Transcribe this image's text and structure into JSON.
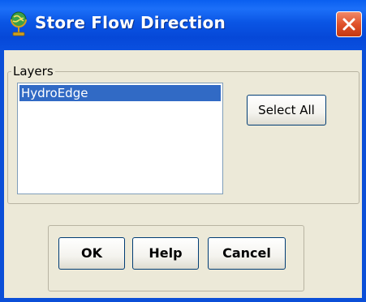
{
  "window": {
    "title": "Store Flow Direction",
    "icon": "globe-stand-icon",
    "close_icon": "close-icon"
  },
  "layers_group": {
    "legend": "Layers",
    "items": [
      {
        "label": "HydroEdge",
        "selected": true
      }
    ],
    "select_all_label": "Select All"
  },
  "buttons": {
    "ok_label": "OK",
    "help_label": "Help",
    "cancel_label": "Cancel"
  },
  "colors": {
    "titlebar": "#0a55e4",
    "selection": "#316ac5",
    "dialog_bg": "#ece9d8",
    "close_button": "#e0512a"
  }
}
